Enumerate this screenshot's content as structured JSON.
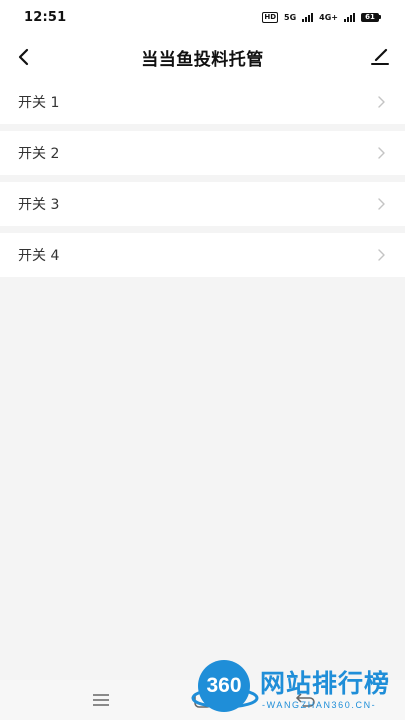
{
  "status_bar": {
    "time": "12:51",
    "hd": "HD",
    "net1": "5G",
    "net2": "4G+",
    "battery": "61"
  },
  "header": {
    "title": "当当鱼投料托管"
  },
  "list": {
    "items": [
      {
        "label": "开关 1"
      },
      {
        "label": "开关 2"
      },
      {
        "label": "开关 3"
      },
      {
        "label": "开关 4"
      }
    ]
  },
  "watermark": {
    "logo": "360",
    "text": "网站排行榜",
    "sub": "-WANGZHAN360.CN-"
  },
  "colors": {
    "background": "#f4f4f4",
    "surface": "#ffffff",
    "watermark_blue": "#1f8ed8"
  }
}
